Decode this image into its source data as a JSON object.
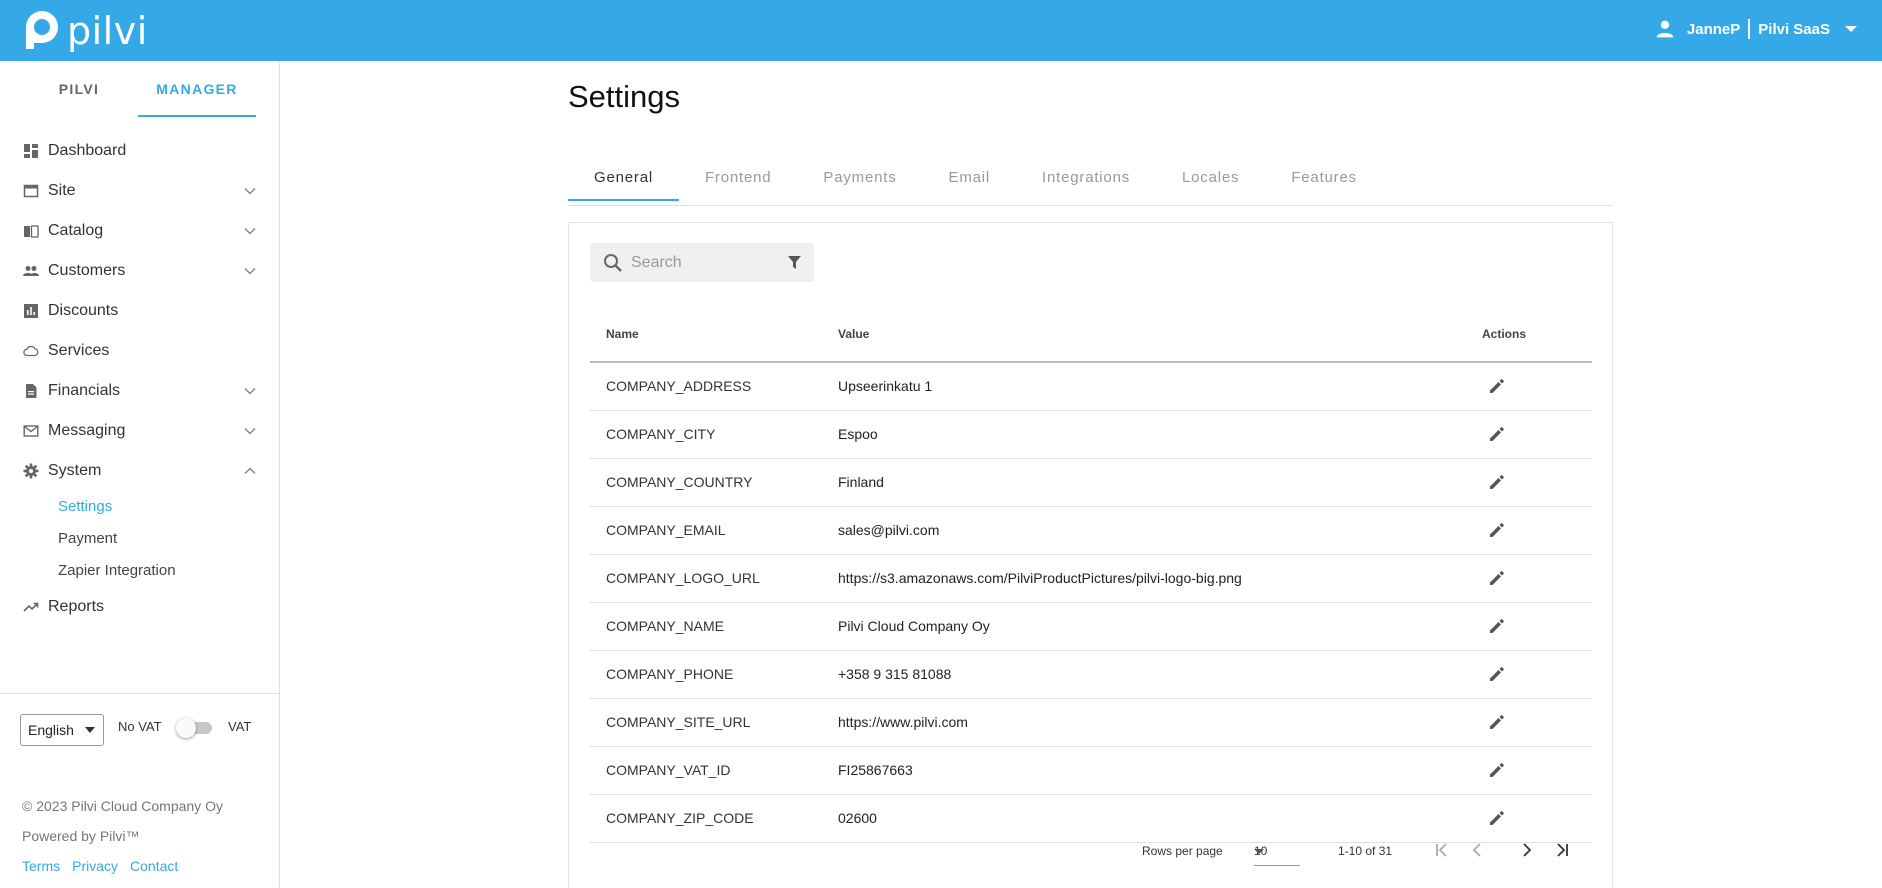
{
  "header": {
    "logo_text": "pilvi",
    "user_name": "JanneP",
    "tenant": "Pilvi SaaS"
  },
  "sidebar": {
    "tabs": [
      {
        "label": "PILVI",
        "active": false
      },
      {
        "label": "MANAGER",
        "active": true
      }
    ],
    "items": [
      {
        "label": "Dashboard",
        "icon": "dashboard-icon",
        "expandable": false
      },
      {
        "label": "Site",
        "icon": "window-icon",
        "expandable": true
      },
      {
        "label": "Catalog",
        "icon": "book-icon",
        "expandable": true
      },
      {
        "label": "Customers",
        "icon": "people-icon",
        "expandable": true
      },
      {
        "label": "Discounts",
        "icon": "chart-box-icon",
        "expandable": false
      },
      {
        "label": "Services",
        "icon": "cloud-icon",
        "expandable": false
      },
      {
        "label": "Financials",
        "icon": "document-icon",
        "expandable": true
      },
      {
        "label": "Messaging",
        "icon": "mail-icon",
        "expandable": true
      },
      {
        "label": "System",
        "icon": "gear-icon",
        "expandable": true,
        "expanded": true
      },
      {
        "label": "Reports",
        "icon": "trending-up-icon",
        "expandable": false
      }
    ],
    "system_subitems": [
      {
        "label": "Settings",
        "active": true
      },
      {
        "label": "Payment",
        "active": false
      },
      {
        "label": "Zapier Integration",
        "active": false
      }
    ],
    "language": "English",
    "vat_off_label": "No VAT",
    "vat_on_label": "VAT",
    "copyright": "© 2023 Pilvi Cloud Company Oy",
    "powered_by": "Powered by Pilvi™",
    "links": [
      "Terms",
      "Privacy",
      "Contact"
    ]
  },
  "main": {
    "title": "Settings",
    "tabs": [
      "General",
      "Frontend",
      "Payments",
      "Email",
      "Integrations",
      "Locales",
      "Features"
    ],
    "active_tab": "General",
    "search_placeholder": "Search",
    "table": {
      "columns": [
        "Name",
        "Value",
        "Actions"
      ],
      "rows": [
        {
          "name": "COMPANY_ADDRESS",
          "value": "Upseerinkatu 1"
        },
        {
          "name": "COMPANY_CITY",
          "value": "Espoo"
        },
        {
          "name": "COMPANY_COUNTRY",
          "value": "Finland"
        },
        {
          "name": "COMPANY_EMAIL",
          "value": "sales@pilvi.com"
        },
        {
          "name": "COMPANY_LOGO_URL",
          "value": "https://s3.amazonaws.com/PilviProductPictures/pilvi-logo-big.png"
        },
        {
          "name": "COMPANY_NAME",
          "value": "Pilvi Cloud Company Oy"
        },
        {
          "name": "COMPANY_PHONE",
          "value": "+358 9 315 81088"
        },
        {
          "name": "COMPANY_SITE_URL",
          "value": "https://www.pilvi.com"
        },
        {
          "name": "COMPANY_VAT_ID",
          "value": "FI25867663"
        },
        {
          "name": "COMPANY_ZIP_CODE",
          "value": "02600"
        }
      ]
    },
    "pagination": {
      "rows_per_page_label": "Rows per page",
      "rows_per_page": "10",
      "range": "1-10 of 31"
    }
  },
  "colors": {
    "accent": "#35a9e7"
  }
}
